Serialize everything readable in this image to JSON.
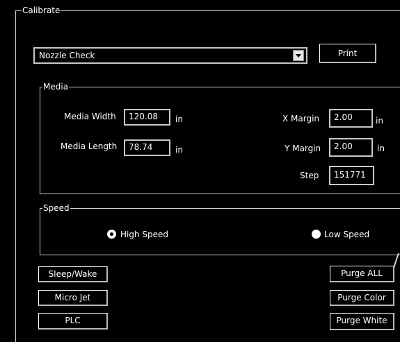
{
  "calibrate": {
    "title": "Calibrate",
    "pattern_select": {
      "value": "Nozzle Check",
      "arrow_icon": "chevron-down-icon"
    },
    "print_label": "Print"
  },
  "media": {
    "title": "Media",
    "width_label": "Media Width",
    "width_value": "120.08",
    "width_unit": "in",
    "length_label": "Media Length",
    "length_value": "78.74",
    "length_unit": "in",
    "xmargin_label": "X Margin",
    "xmargin_value": "2.00",
    "xmargin_unit": "in",
    "ymargin_label": "Y Margin",
    "ymargin_value": "2.00",
    "ymargin_unit": "in",
    "step_label": "Step",
    "step_value": "151771"
  },
  "speed": {
    "title": "Speed",
    "high_label": "High Speed",
    "high_selected": true,
    "low_label": "Low Speed",
    "low_selected": false
  },
  "buttons": {
    "sleep_wake": "Sleep/Wake",
    "micro_jet": "Micro Jet",
    "plc": "PLC",
    "purge_all": "Purge ALL",
    "purge_color": "Purge Color",
    "purge_white": "Purge White"
  }
}
